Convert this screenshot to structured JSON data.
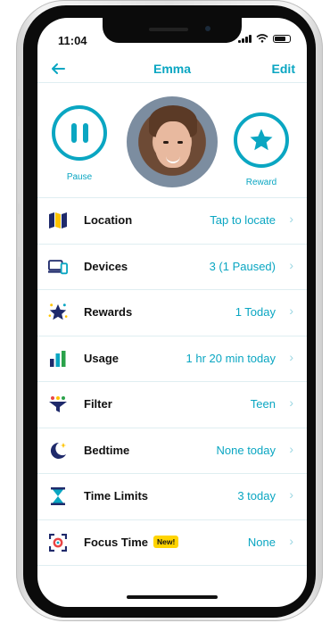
{
  "status": {
    "time": "11:04"
  },
  "nav": {
    "title": "Emma",
    "edit_label": "Edit"
  },
  "actions": {
    "pause_label": "Pause",
    "reward_label": "Reward"
  },
  "rows": [
    {
      "label": "Location",
      "value": "Tap to locate",
      "icon": "map-icon",
      "badge": ""
    },
    {
      "label": "Devices",
      "value": "3 (1 Paused)",
      "icon": "devices-icon",
      "badge": ""
    },
    {
      "label": "Rewards",
      "value": "1 Today",
      "icon": "star-icon",
      "badge": ""
    },
    {
      "label": "Usage",
      "value": "1 hr 20 min today",
      "icon": "bar-chart-icon",
      "badge": ""
    },
    {
      "label": "Filter",
      "value": "Teen",
      "icon": "filter-icon",
      "badge": ""
    },
    {
      "label": "Bedtime",
      "value": "None today",
      "icon": "moon-icon",
      "badge": ""
    },
    {
      "label": "Time Limits",
      "value": "3 today",
      "icon": "hourglass-icon",
      "badge": ""
    },
    {
      "label": "Focus Time",
      "value": "None",
      "icon": "focus-icon",
      "badge": "New!"
    }
  ],
  "colors": {
    "accent": "#0aa6c2",
    "badge": "#ffd400",
    "navy": "#1f2a6b"
  }
}
